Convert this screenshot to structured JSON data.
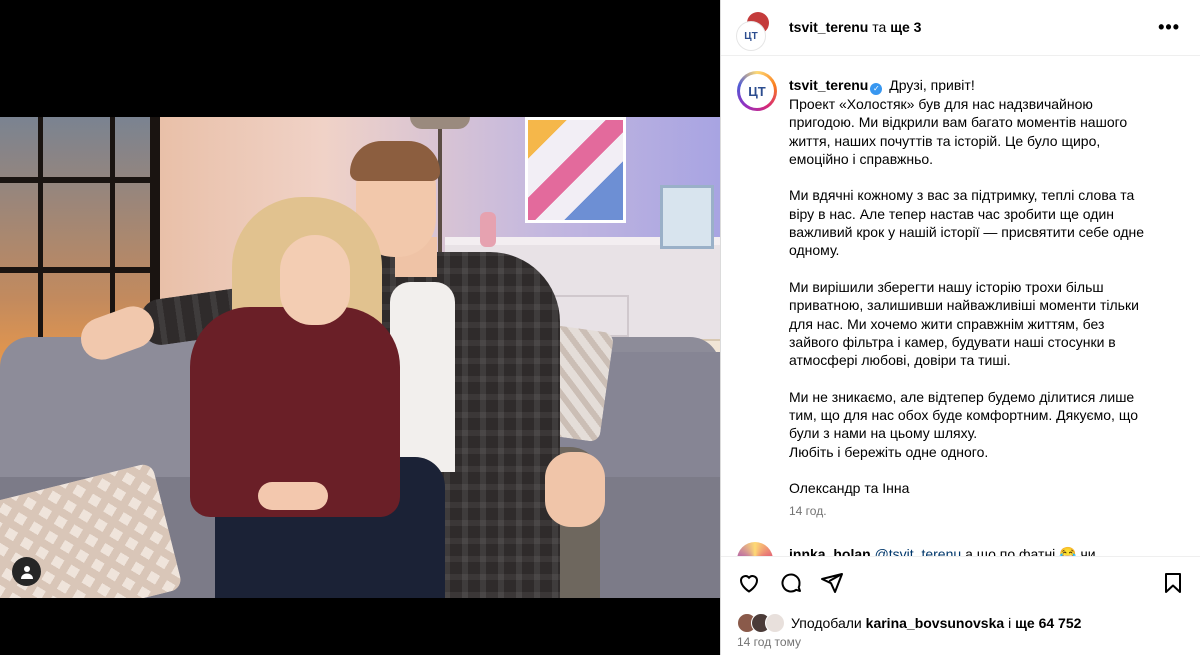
{
  "header": {
    "username": "tsvit_terenu",
    "connector": "та",
    "others": "ще 3",
    "more_label": "•••"
  },
  "caption": {
    "username": "tsvit_terenu",
    "verified_mark": "✓",
    "avatar_glyph": "ЦТ",
    "first_line": "Друзі, привіт!",
    "paragraphs": [
      "Проект «Холостяк» був для нас надзвичайною\nпригодою. Ми відкрили вам багато моментів нашого\nжиття, наших почуттів та історій. Це було щиро,\nемоційно і справжньо.",
      "Ми вдячні кожному з вас за підтримку, теплі слова та\nвіру в нас. Але тепер настав час зробити ще один\nважливий крок у нашій історії — присвятити себе одне\nодному.",
      "Ми вирішили зберегти нашу історію трохи більш\nприватною, залишивши найважливіші моменти тільки\nдля нас. Ми хочемо жити справжнім життям, без\nзайвого фільтра і камер, будувати наші стосунки в\nатмосфері любові, довіри та тиші.",
      "Ми не зникаємо, але відтепер будемо ділитися лише\nтим, що для нас обох буде комфортним. Дякуємо, що\nбули з нами на цьому шляху.\nЛюбіть і бережіть одне одного.",
      "Олександр та Інна"
    ],
    "time": "14 год."
  },
  "comment_peek": {
    "username": "innka_holan",
    "mention": "@tsvit_terenu",
    "text": "а що по фатні 😂 чи"
  },
  "actions": {
    "like_icon": "heart-icon",
    "comment_icon": "comment-icon",
    "share_icon": "share-icon",
    "save_icon": "bookmark-icon"
  },
  "likes": {
    "prefix": "Уподобали",
    "user": "karina_bovsunovska",
    "connector": "і",
    "count": "ще 64 752"
  },
  "posted_ago": "14 год тому",
  "colors": {
    "link": "#00376b",
    "verified": "#3897f0",
    "muted": "#737373"
  }
}
